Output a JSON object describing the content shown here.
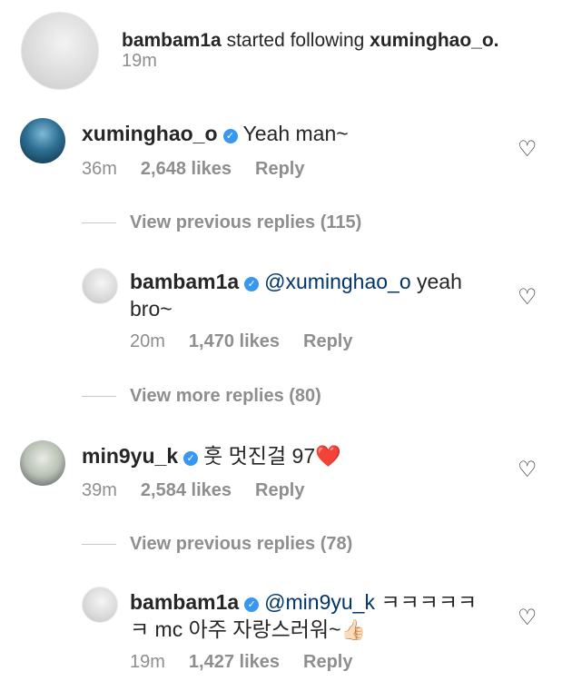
{
  "notification": {
    "username": "bambam1a",
    "action": "started following",
    "target": "xuminghao_o.",
    "time": "19m"
  },
  "comments": [
    {
      "username": "xuminghao_o",
      "text": "Yeah man~",
      "time": "36m",
      "likes": "2,648 likes",
      "reply": "Reply",
      "view_replies": "View previous replies (115)"
    },
    {
      "username": "bambam1a",
      "mention": "@xuminghao_o",
      "text_line1": "yeah",
      "text_line2": "bro~",
      "time": "20m",
      "likes": "1,470 likes",
      "reply": "Reply",
      "view_replies": "View more replies (80)"
    },
    {
      "username": "min9yu_k",
      "text": "훗 멋진걸 97",
      "emoji": "❤️",
      "time": "39m",
      "likes": "2,584 likes",
      "reply": "Reply",
      "view_replies": "View previous replies (78)"
    },
    {
      "username": "bambam1a",
      "mention": "@min9yu_k",
      "text_line1": "ㅋㅋㅋㅋㅋ",
      "text_line2": "ㅋ mc 아주 자랑스러워~",
      "emoji": "👍🏻",
      "time": "19m",
      "likes": "1,427 likes",
      "reply": "Reply"
    }
  ],
  "icons": {
    "verified": "verified-badge-icon",
    "like": "heart-outline-icon"
  },
  "colors": {
    "verified": "#3897f0",
    "meta": "#8e8e8e",
    "text": "#262626"
  }
}
